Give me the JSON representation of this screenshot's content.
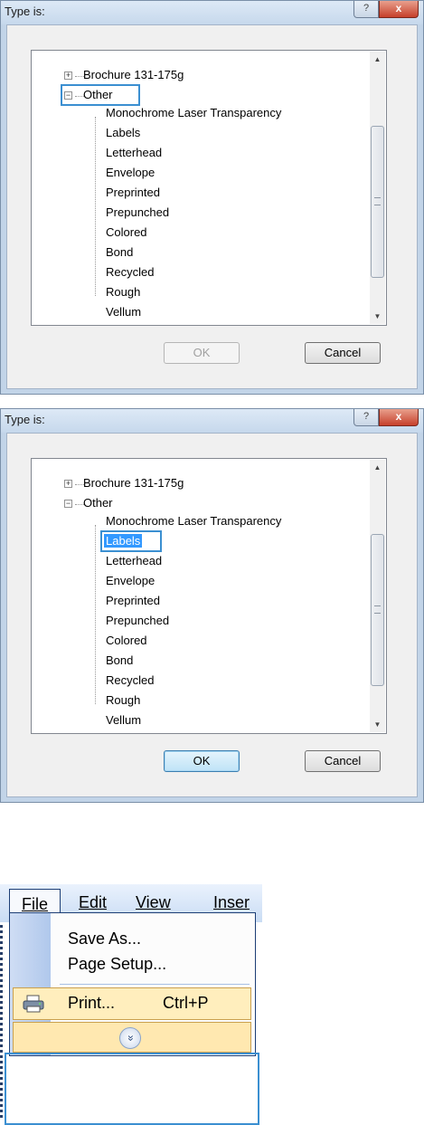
{
  "dialog1": {
    "title": "Type is:",
    "caption": {
      "help": "?",
      "close": "x"
    },
    "tree": {
      "partial_top": "Brochure 131-175g",
      "parent": "Other",
      "items": [
        "Monochrome Laser Transparency",
        "Labels",
        "Letterhead",
        "Envelope",
        "Preprinted",
        "Prepunched",
        "Colored",
        "Bond",
        "Recycled",
        "Rough",
        "Vellum"
      ]
    },
    "ok_label": "OK",
    "cancel_label": "Cancel",
    "selected_item": "Other"
  },
  "dialog2": {
    "title": "Type is:",
    "caption": {
      "help": "?",
      "close": "x"
    },
    "tree": {
      "partial_top": "Brochure 131-175g",
      "parent": "Other",
      "items": [
        "Monochrome Laser Transparency",
        "Labels",
        "Letterhead",
        "Envelope",
        "Preprinted",
        "Prepunched",
        "Colored",
        "Bond",
        "Recycled",
        "Rough",
        "Vellum"
      ]
    },
    "ok_label": "OK",
    "cancel_label": "Cancel",
    "selected_item": "Labels"
  },
  "office_menu": {
    "menubar": {
      "file": "File",
      "edit": "Edit",
      "view": "View",
      "insert": "Inser"
    },
    "items": {
      "save_as": "Save As...",
      "page_setup": "Page Setup...",
      "print": "Print...",
      "print_shortcut": "Ctrl+P"
    },
    "expand_icon": "chevron-double-down-icon"
  },
  "colors": {
    "selection": "#3399ff",
    "highlight_border": "#3b8fd1",
    "menu_hover": "#ffeebd"
  }
}
